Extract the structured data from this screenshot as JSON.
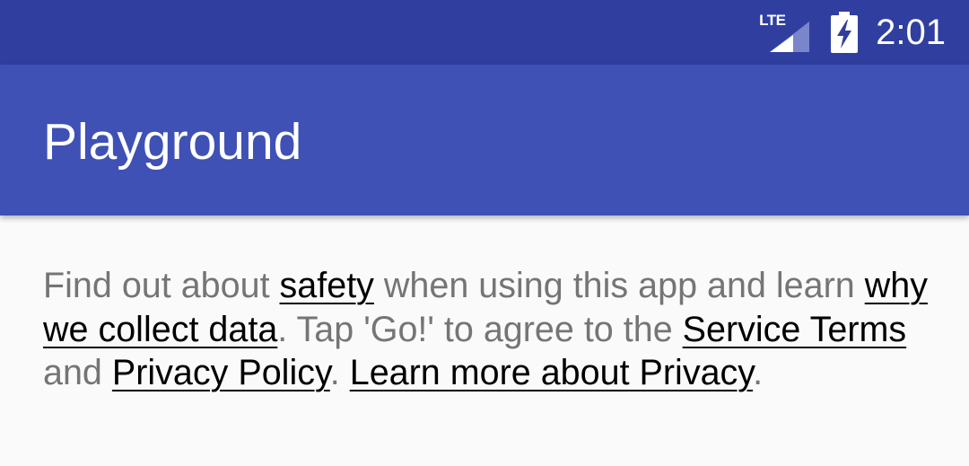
{
  "status_bar": {
    "network_label": "LTE",
    "signal_icon": "cell-signal-icon",
    "battery_icon": "battery-charging-icon",
    "time": "2:01"
  },
  "app_bar": {
    "title": "Playground"
  },
  "consent": {
    "seg1": "Find out about ",
    "link_safety": "safety",
    "seg2": " when using this app and learn ",
    "link_why_collect": "why we collect data",
    "seg3": ". Tap 'Go!' to agree to the ",
    "link_service_terms": "Service Terms",
    "seg4": " and ",
    "link_privacy_policy": "Privacy Policy",
    "seg5": ". ",
    "link_learn_more": "Learn more about Privacy",
    "seg6": "."
  },
  "colors": {
    "status_bar": "#303f9f",
    "app_bar": "#3f51b5",
    "background": "#fafafa",
    "body_text": "#757575",
    "link_text": "#000000"
  }
}
